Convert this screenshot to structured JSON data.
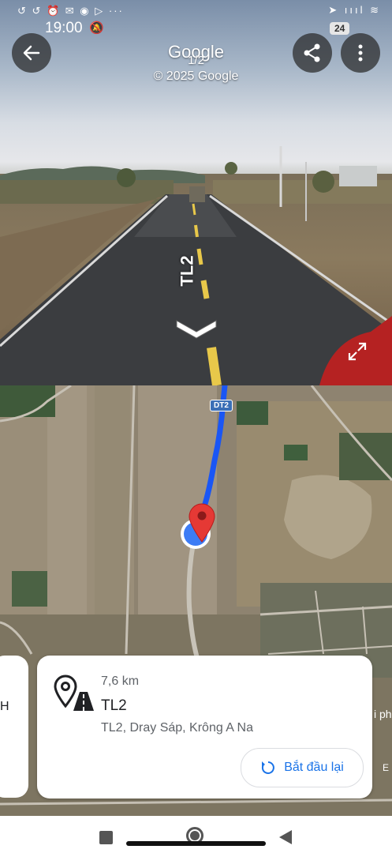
{
  "status_bar": {
    "time": "19:00",
    "left_icons": "↺ ↺ ⏰ ✉ ◉ ▷ ···",
    "right_icons": "➤ ıııl ≋",
    "battery_level": "24"
  },
  "street_view": {
    "title": "Google",
    "counter": "1/2",
    "copyright": "© 2025 Google",
    "road_label": "TL2",
    "icons": [
      "back-arrow-icon",
      "share-icon",
      "more-vert-icon",
      "chevron-icon",
      "expand-icon"
    ]
  },
  "map": {
    "route_shield": "DT2",
    "route_color": "#1a56f5",
    "pin_color": "#e53935"
  },
  "left_card": {
    "partial_text": "H"
  },
  "place_card": {
    "distance": "7,6 km",
    "name": "TL2",
    "address": "TL2, Dray Sáp, Krông A Na",
    "restart_label": "Bắt đầu lại",
    "accent_color": "#1a73e8"
  },
  "map_edge_text": {
    "right_1": "i ph",
    "right_2": "E"
  }
}
